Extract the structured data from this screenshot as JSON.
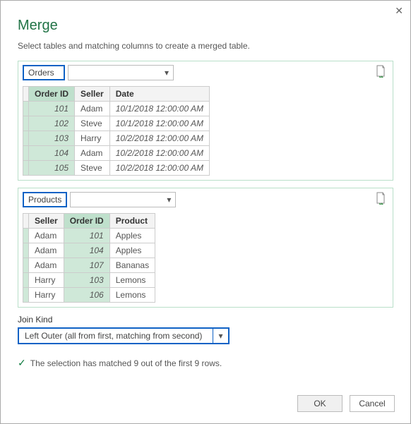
{
  "title": "Merge",
  "subtitle": "Select tables and matching columns to create a merged table.",
  "table1": {
    "name": "Orders",
    "cols": [
      "Order ID",
      "Seller",
      "Date"
    ],
    "selectedColIndex": 0,
    "rows": [
      [
        "101",
        "Adam",
        "10/1/2018 12:00:00 AM"
      ],
      [
        "102",
        "Steve",
        "10/1/2018 12:00:00 AM"
      ],
      [
        "103",
        "Harry",
        "10/2/2018 12:00:00 AM"
      ],
      [
        "104",
        "Adam",
        "10/2/2018 12:00:00 AM"
      ],
      [
        "105",
        "Steve",
        "10/2/2018 12:00:00 AM"
      ]
    ]
  },
  "table2": {
    "name": "Products",
    "cols": [
      "Seller",
      "Order ID",
      "Product"
    ],
    "selectedColIndex": 1,
    "rows": [
      [
        "Adam",
        "101",
        "Apples"
      ],
      [
        "Adam",
        "104",
        "Apples"
      ],
      [
        "Adam",
        "107",
        "Bananas"
      ],
      [
        "Harry",
        "103",
        "Lemons"
      ],
      [
        "Harry",
        "106",
        "Lemons"
      ]
    ]
  },
  "joinKind": {
    "label": "Join Kind",
    "value": "Left Outer (all from first, matching from second)"
  },
  "status": "The selection has matched 9 out of the first 9 rows.",
  "buttons": {
    "ok": "OK",
    "cancel": "Cancel"
  }
}
